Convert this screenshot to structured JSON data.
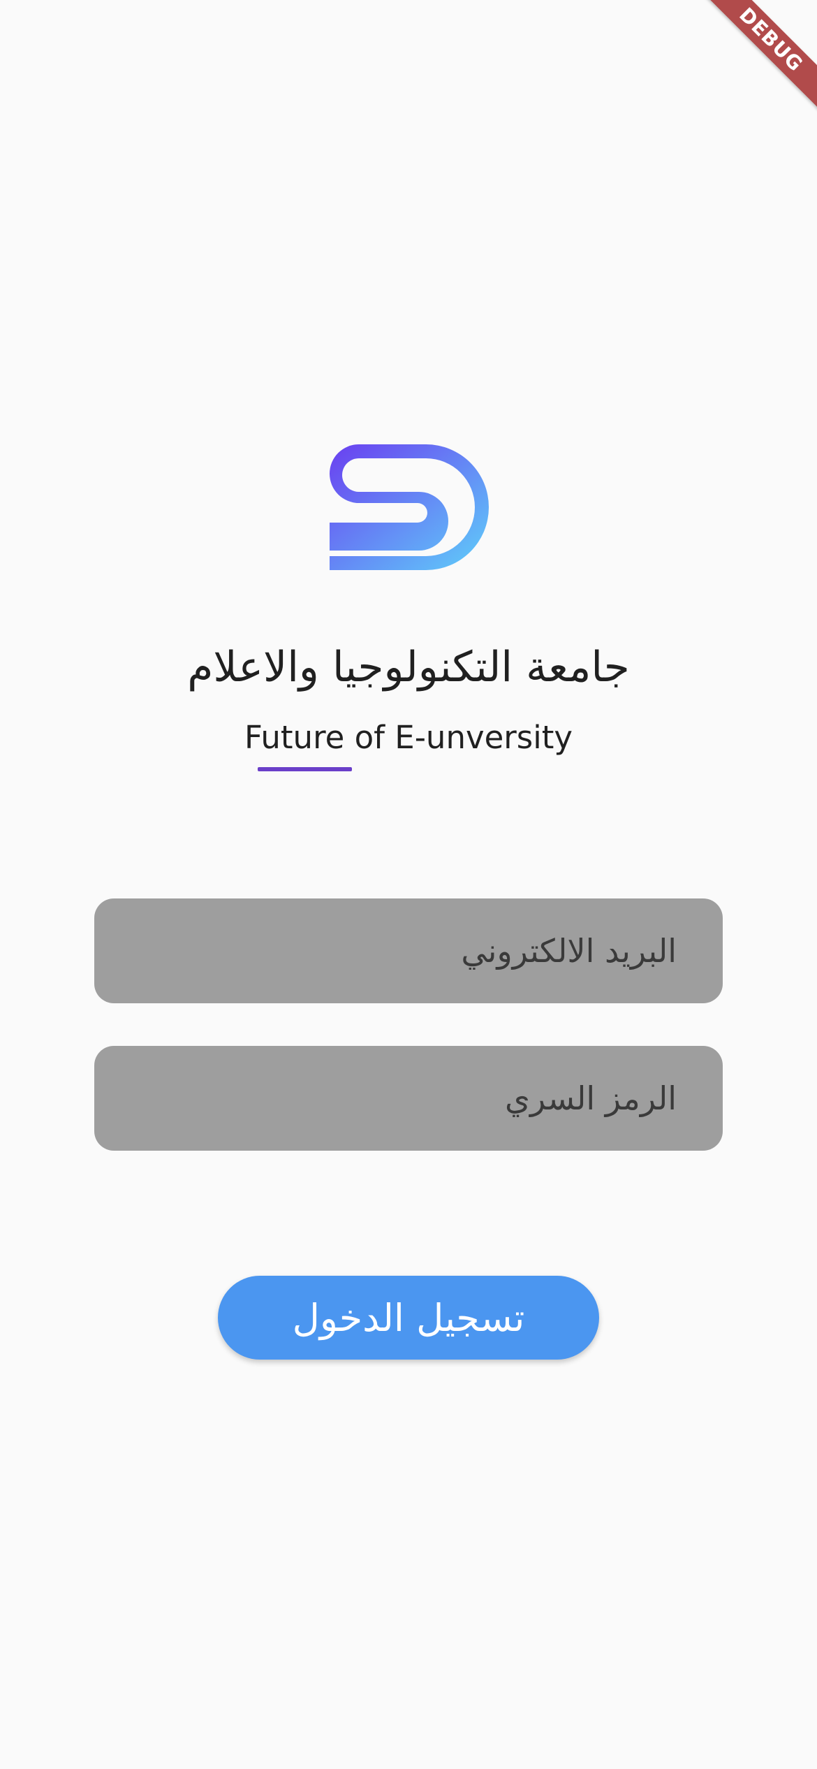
{
  "debug_banner": {
    "label": "DEBUG",
    "color": "#b14b4b"
  },
  "logo": {
    "icon": "s-d-logo-icon",
    "gradient_start": "#6a3ff0",
    "gradient_end": "#5fd0fa"
  },
  "header": {
    "title": "جامعة التكنولوجيا والاعلام",
    "subtitle": "Future of E-unversity",
    "underline_color": "#6a3fc9"
  },
  "form": {
    "email": {
      "placeholder": "البريد الالكتروني",
      "value": ""
    },
    "password": {
      "placeholder": "الرمز السري",
      "value": ""
    },
    "field_color": "#9e9e9e"
  },
  "login_button": {
    "label": "تسجيل الدخول",
    "color": "#4b96f0"
  }
}
